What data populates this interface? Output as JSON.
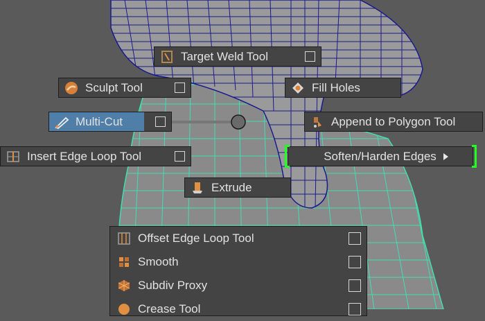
{
  "marking_menu": {
    "target_weld": {
      "label": "Target Weld Tool",
      "icon": "target-weld-icon"
    },
    "sculpt": {
      "label": "Sculpt Tool",
      "icon": "sculpt-icon"
    },
    "fill_holes": {
      "label": "Fill Holes",
      "icon": "fill-holes-icon"
    },
    "multi_cut": {
      "label": "Multi-Cut",
      "icon": "knife-icon"
    },
    "append_polygon": {
      "label": "Append to Polygon Tool",
      "icon": "append-icon"
    },
    "insert_edge_loop": {
      "label": "Insert Edge Loop Tool",
      "icon": "edge-loop-icon"
    },
    "soften_harden": {
      "label": "Soften/Harden Edges",
      "icon": "chevron-right-icon"
    },
    "extrude": {
      "label": "Extrude",
      "icon": "extrude-icon"
    }
  },
  "submenu": {
    "items": [
      {
        "label": "Offset Edge Loop Tool",
        "icon": "offset-loop-icon"
      },
      {
        "label": "Smooth",
        "icon": "smooth-icon"
      },
      {
        "label": "Subdiv Proxy",
        "icon": "subdiv-proxy-icon"
      },
      {
        "label": "Crease Tool",
        "icon": "crease-icon"
      }
    ]
  },
  "colors": {
    "menu_bg": "#444444",
    "highlight": "#4f7fa8",
    "wire_selected": "#40e0b0",
    "wire_unselected": "#1a1a8c",
    "focus_bracket": "#20ff20"
  }
}
